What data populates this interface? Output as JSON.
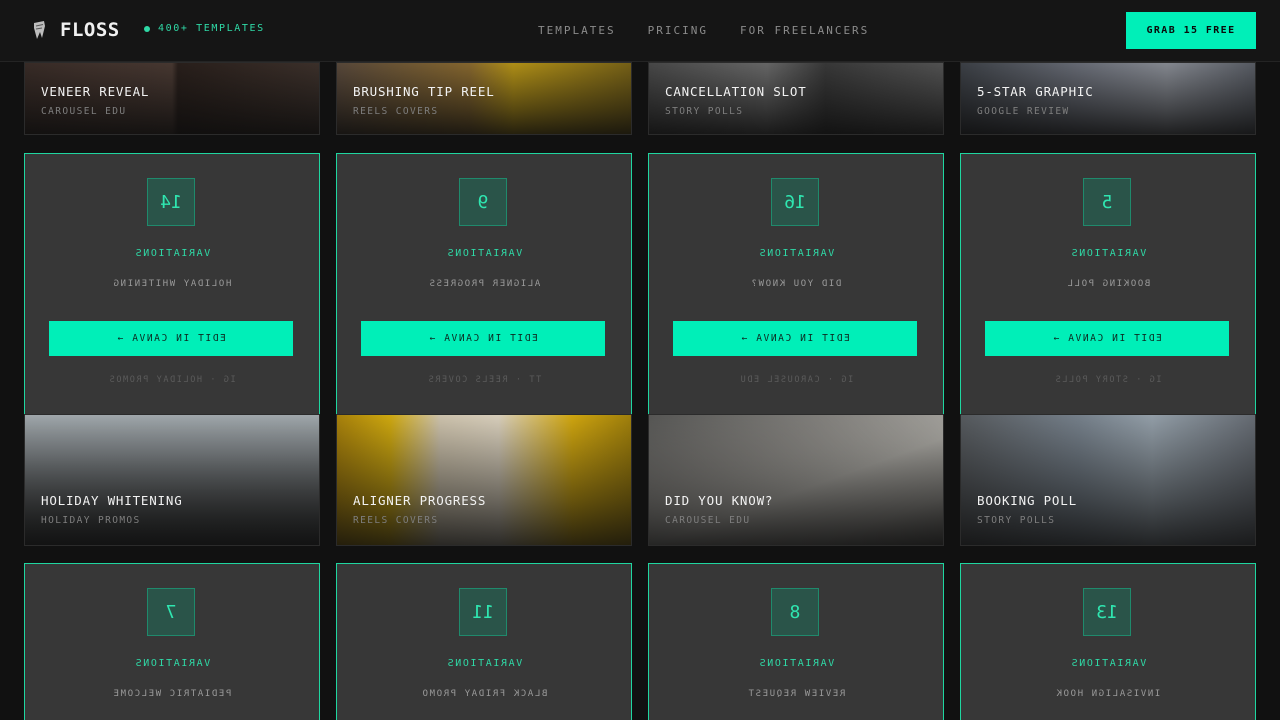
{
  "header": {
    "brand": "FLOSS",
    "badge": "400+ TEMPLATES",
    "nav": [
      "TEMPLATES",
      "PRICING",
      "FOR FREELANCERS"
    ],
    "cta": "GRAB 15 FREE"
  },
  "colors": {
    "accent": "#00efb8",
    "accent_text": "#2fd9a6",
    "card_bg": "#373737",
    "page_bg": "#111111"
  },
  "variation_label": "VARIATIONS",
  "edit_label": "EDIT IN CANVA →",
  "top_row": [
    {
      "title": "VENEER REVEAL",
      "category": "CAROUSEL EDU"
    },
    {
      "title": "BRUSHING TIP REEL",
      "category": "REELS COVERS"
    },
    {
      "title": "CANCELLATION SLOT",
      "category": "STORY POLLS"
    },
    {
      "title": "5-STAR GRAPHIC",
      "category": "GOOGLE REVIEW"
    }
  ],
  "variation_row_1": [
    {
      "count": "14",
      "name": "HOLIDAY WHITENING",
      "meta": "IG · HOLIDAY PROMOS"
    },
    {
      "count": "9",
      "name": "ALIGNER PROGRESS",
      "meta": "TT · REELS COVERS"
    },
    {
      "count": "16",
      "name": "DID YOU KNOW?",
      "meta": "IG · CAROUSEL EDU"
    },
    {
      "count": "5",
      "name": "BOOKING POLL",
      "meta": "IG · STORY POLLS"
    }
  ],
  "photo_row_2": [
    {
      "title": "HOLIDAY WHITENING",
      "category": "HOLIDAY PROMOS"
    },
    {
      "title": "ALIGNER PROGRESS",
      "category": "REELS COVERS"
    },
    {
      "title": "DID YOU KNOW?",
      "category": "CAROUSEL EDU"
    },
    {
      "title": "BOOKING POLL",
      "category": "STORY POLLS"
    }
  ],
  "variation_row_2": [
    {
      "count": "7",
      "name": "PEDIATRIC WELCOME"
    },
    {
      "count": "11",
      "name": "BLACK FRIDAY PROMO"
    },
    {
      "count": "8",
      "name": "REVIEW REQUEST"
    },
    {
      "count": "13",
      "name": "INVISALIGN HOOK"
    }
  ]
}
